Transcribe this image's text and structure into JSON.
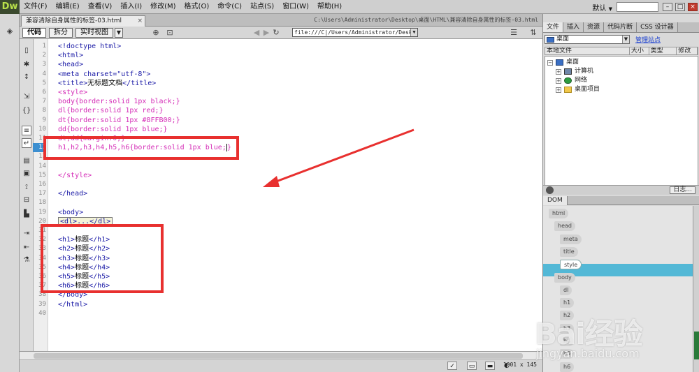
{
  "app": {
    "logo": "Dw",
    "menu": [
      "文件(F)",
      "编辑(E)",
      "查看(V)",
      "插入(I)",
      "修改(M)",
      "格式(O)",
      "命令(C)",
      "站点(S)",
      "窗口(W)",
      "帮助(H)"
    ],
    "workspace": "默认",
    "workspace_arrow": "▼"
  },
  "document": {
    "tab_title": "兼容清除自身属性的标签-03.html",
    "tab_close": "×",
    "path": "C:\\Users\\Administrator\\Desktop\\桌面\\HTML\\兼容清除自身属性的标签-03.html",
    "view_buttons": {
      "code": "代码",
      "split": "拆分",
      "live": "实时视图"
    },
    "url": "file:///C|/Users/Administrator/Desktop"
  },
  "code": {
    "lines": [
      {
        "n": "1",
        "parts": [
          {
            "t": "<!doctype html>",
            "c": "tag"
          }
        ]
      },
      {
        "n": "2",
        "parts": [
          {
            "t": "<html>",
            "c": "tag"
          }
        ]
      },
      {
        "n": "3",
        "parts": [
          {
            "t": "<head>",
            "c": "tag"
          }
        ]
      },
      {
        "n": "4",
        "parts": [
          {
            "t": "<meta charset=\"utf-8\">",
            "c": "tag"
          }
        ]
      },
      {
        "n": "5",
        "parts": [
          {
            "t": "<title>",
            "c": "tag"
          },
          {
            "t": "无标题文档",
            "c": "text"
          },
          {
            "t": "</title>",
            "c": "tag"
          }
        ]
      },
      {
        "n": "6",
        "parts": [
          {
            "t": "<style>",
            "c": "css"
          }
        ]
      },
      {
        "n": "7",
        "parts": [
          {
            "t": "body{border:solid 1px black;}",
            "c": "css"
          }
        ]
      },
      {
        "n": "8",
        "parts": [
          {
            "t": "dl{border:solid 1px red;}",
            "c": "css"
          }
        ]
      },
      {
        "n": "9",
        "parts": [
          {
            "t": "dt{border:solid 1px #8FFB00;}",
            "c": "css"
          }
        ]
      },
      {
        "n": "10",
        "parts": [
          {
            "t": "dd{border:solid 1px blue;}",
            "c": "css"
          }
        ]
      },
      {
        "n": "11",
        "parts": [
          {
            "t": "dt,dd{margin:0;}",
            "c": "css"
          }
        ]
      },
      {
        "n": "12",
        "parts": [
          {
            "t": "h1,h2,h3,h4,h5,h6{border:solid 1px blue;",
            "c": "css"
          },
          {
            "t": "}",
            "c": "css"
          }
        ],
        "current": true
      },
      {
        "n": "13",
        "parts": []
      },
      {
        "n": "14",
        "parts": []
      },
      {
        "n": "15",
        "parts": [
          {
            "t": "</style>",
            "c": "css"
          }
        ]
      },
      {
        "n": "16",
        "parts": []
      },
      {
        "n": "17",
        "parts": [
          {
            "t": "</head>",
            "c": "tag"
          }
        ]
      },
      {
        "n": "18",
        "parts": []
      },
      {
        "n": "19",
        "parts": [
          {
            "t": "<body>",
            "c": "tag"
          }
        ]
      },
      {
        "n": "20",
        "parts": [
          {
            "t": "<dl>...</dl>",
            "c": "collapsed"
          }
        ]
      },
      {
        "n": "31",
        "parts": []
      },
      {
        "n": "32",
        "parts": [
          {
            "t": "<h1>",
            "c": "tag"
          },
          {
            "t": "标题",
            "c": "text"
          },
          {
            "t": "</h1>",
            "c": "tag"
          }
        ]
      },
      {
        "n": "33",
        "parts": [
          {
            "t": "<h2>",
            "c": "tag"
          },
          {
            "t": "标题",
            "c": "text"
          },
          {
            "t": "</h2>",
            "c": "tag"
          }
        ]
      },
      {
        "n": "34",
        "parts": [
          {
            "t": "<h3>",
            "c": "tag"
          },
          {
            "t": "标题",
            "c": "text"
          },
          {
            "t": "</h3>",
            "c": "tag"
          }
        ]
      },
      {
        "n": "35",
        "parts": [
          {
            "t": "<h4>",
            "c": "tag"
          },
          {
            "t": "标题",
            "c": "text"
          },
          {
            "t": "</h4>",
            "c": "tag"
          }
        ]
      },
      {
        "n": "36",
        "parts": [
          {
            "t": "<h5>",
            "c": "tag"
          },
          {
            "t": "标题",
            "c": "text"
          },
          {
            "t": "</h5>",
            "c": "tag"
          }
        ]
      },
      {
        "n": "37",
        "parts": [
          {
            "t": "<h6>",
            "c": "tag"
          },
          {
            "t": "标题",
            "c": "text"
          },
          {
            "t": "</h6>",
            "c": "tag"
          }
        ]
      },
      {
        "n": "38",
        "parts": [
          {
            "t": "</body>",
            "c": "tag"
          }
        ]
      },
      {
        "n": "39",
        "parts": [
          {
            "t": "</html>",
            "c": "tag"
          }
        ]
      },
      {
        "n": "40",
        "parts": []
      }
    ]
  },
  "status": {
    "size": "1001 x 145"
  },
  "files_panel": {
    "tabs": [
      "文件",
      "插入",
      "资源",
      "代码片断",
      "CSS 设计器"
    ],
    "site": "桌面",
    "manage_link": "管理站点",
    "columns": [
      "本地文件",
      "大小",
      "类型",
      "修改"
    ],
    "tree": [
      {
        "label": "桌面",
        "icon": "desktop-icon",
        "expander": "−",
        "level": 0
      },
      {
        "label": "计算机",
        "icon": "computer-icon",
        "expander": "+",
        "level": 1
      },
      {
        "label": "网络",
        "icon": "network-icon",
        "expander": "+",
        "level": 1
      },
      {
        "label": "桌面项目",
        "icon": "folder-icon",
        "expander": "+",
        "level": 1
      }
    ],
    "log_button": "日志..."
  },
  "dom_panel": {
    "tab": "DOM",
    "nodes": [
      "html",
      "head",
      "meta",
      "title",
      "style",
      "body",
      "dl",
      "h1",
      "h2",
      "h3",
      "h4",
      "h5",
      "h6"
    ],
    "selected": "style"
  },
  "watermark": {
    "logo": "Bai经验",
    "url": "jingyan.baidu.com"
  },
  "colors": {
    "annotation_red": "#e8302f",
    "current_line": "#3d8fd0",
    "dom_selection": "#53b8d6"
  }
}
